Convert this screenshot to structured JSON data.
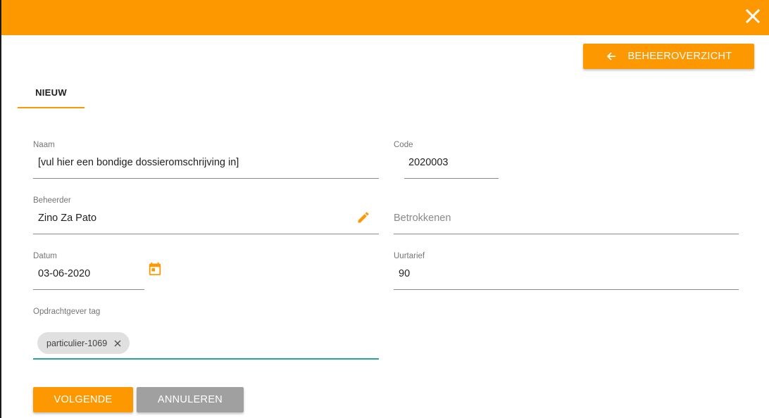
{
  "header": {
    "close_icon": "close-icon",
    "back_button_label": "BEHEEROVERZICHT",
    "back_icon": "arrow-left-icon"
  },
  "tabs": [
    {
      "label": "NIEUW",
      "active": true
    }
  ],
  "form": {
    "naam": {
      "label": "Naam",
      "value": "[vul hier een bondige dossieromschrijving in]"
    },
    "code": {
      "label": "Code",
      "value": "2020003"
    },
    "beheerder": {
      "label": "Beheerder",
      "value": "Zino Za Pato",
      "icon": "pencil-edit-icon"
    },
    "betrokkenen": {
      "placeholder": "Betrokkenen"
    },
    "datum": {
      "label": "Datum",
      "value": "03-06-2020",
      "icon": "calendar-icon"
    },
    "uurtarief": {
      "label": "Uurtarief",
      "value": "90"
    },
    "opdrachtgever_tag": {
      "label": "Opdrachtgever tag",
      "chips": [
        {
          "label": "particulier-1069",
          "remove_icon": "close-icon"
        }
      ]
    }
  },
  "actions": {
    "next_label": "VOLGENDE",
    "cancel_label": "ANNULEREN"
  },
  "colors": {
    "accent": "#fe9800",
    "focus_underline": "#26a69a",
    "secondary_button": "#a0a0a0",
    "chip_bg": "#e0e0e0"
  }
}
